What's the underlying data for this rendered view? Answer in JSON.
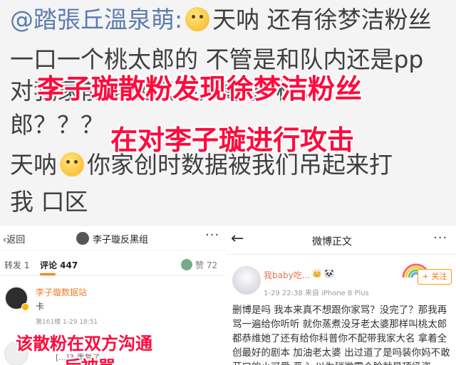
{
  "top_comment": {
    "author": "@踏張丘溫泉萌:",
    "line1_after_emoji": "天呐 还有徐梦洁粉丝",
    "line2": "一口一个桃太郎的 不管是和队内还是pp",
    "line3": "对我家前辈这点不太尊敬 桃太",
    "line4": "郎？？？",
    "line5_after_emoji": "你家创时数据被我们吊起来打",
    "line6": "我 口区",
    "overlay_line1": "李子璇散粉发现徐梦洁粉丝",
    "overlay_line2": "在对李子璇进行攻击"
  },
  "comments_page": {
    "back_label": "‹返回",
    "title": "李子璇反黑组",
    "tab_repost": "转发 1",
    "tab_comment": "评论 447",
    "like_label": "赞 72",
    "comment_name": "李子璇数据站",
    "comment_text": "卡",
    "comment_meta": "第161楼  1-29 18:51",
    "sub_reply": "[...]3 重复了",
    "overlay_line1": "该散粉在双方沟通",
    "overlay_line2": "后被骂"
  },
  "post_page": {
    "title": "微博正文",
    "user_name": "我baby吃...",
    "badges": "👑 🐼",
    "time": "1-29 22:38  来自 iPhone 8 Plus",
    "follow_label": "+ 关注",
    "body": "删博是吗 我本来真不想跟你家骂？没完了？那我再骂一遍给你听听 就你蒸煮没牙老太婆那样叫桃太郎都恭维她了还有给你科普你不配带我家大名 拿着全创最好的剧本 加油老太婆 出过道了是吗装你妈不敢开口的小可爱 恶心 以为稍微露个脸就是顶级姿"
  },
  "colors": {
    "overlay_red": "#ff0a3c",
    "weibo_orange": "#ff8200",
    "author_blue": "#5c7cae"
  }
}
